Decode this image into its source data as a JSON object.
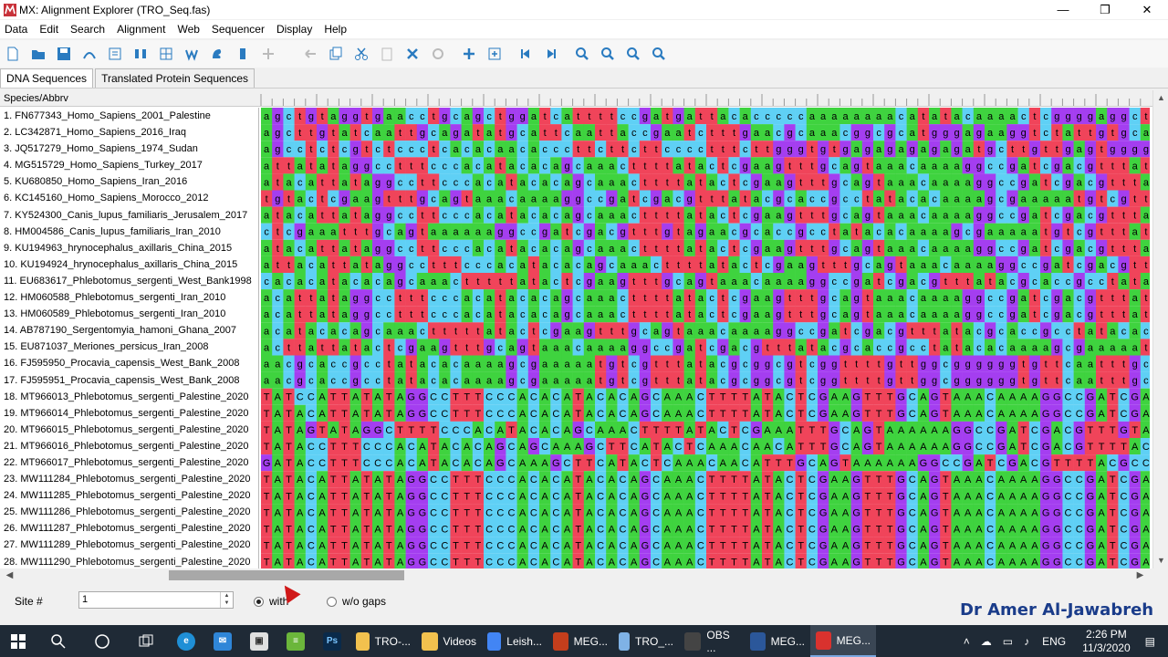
{
  "window": {
    "title": "MX: Alignment Explorer (TRO_Seq.fas)",
    "minimize": "—",
    "restore": "❐",
    "close": "✕"
  },
  "menu": [
    "Data",
    "Edit",
    "Search",
    "Alignment",
    "Web",
    "Sequencer",
    "Display",
    "Help"
  ],
  "tabs": [
    "DNA Sequences",
    "Translated Protein Sequences"
  ],
  "header": {
    "species_col": "Species/Abbrv"
  },
  "sequences": [
    {
      "name": "1. FN677343_Homo_Sapiens_2001_Palestine",
      "seq": "agctgtaggtgaacctgcagctggatcattttccgatgattacacccccaaaaaaaacatatacaaaactcggggaggct"
    },
    {
      "name": "2. LC342871_Homo_Sapiens_2016_Iraq",
      "seq": "agcttgtatcaattgcagatatgcattcaattaccgaatctttgaacgcaaacggcgcatgggagaaggtctattgtgcat"
    },
    {
      "name": "3. JQ517279_Homo_Sapiens_1974_Sudan",
      "seq": "agcctctcgtctccctcacacaacacccttcttcttcccctttcttgggtgtgagagagagagatgcttgttgagtgggg"
    },
    {
      "name": "4. MG515729_Homo_Sapiens_Turkey_2017",
      "seq": "attatataggcctttcccacatacacagcaaacttttatactcgaagtttgcagtaaacaaaaggccgatcgacgtttatc"
    },
    {
      "name": "5. KU680850_Homo_Sapiens_Iran_2016",
      "seq": "atacattataggccttcccacatacacagcaaacttttatactcgaagtttgcagtaaacaaaaggccgatcgacgtttat"
    },
    {
      "name": "6. KC145160_Homo_Sapiens_Morocco_2012",
      "seq": "tgtactcgaagtttgcagtaaacaaaaggccgatcgacgtttatacgcaccgcctatacacaaaagcgaaaaatgtcgtta"
    },
    {
      "name": "7. KY524300_Canis_lupus_familiaris_Jerusalem_2017",
      "seq": "atacattataggccttcccacatacacagcaaacttttatactcgaagtttgcagtaaacaaaaggccgatcgacgtttat"
    },
    {
      "name": "8. HM004586_Canis_lupus_familiaris_Iran_2010",
      "seq": "ctcgaaatttgcagtaaaaaaggccgatcgacgtttgtagaacgcaccgcctatacacaaaagcgaaaaatgtcgtttat"
    },
    {
      "name": "9. KU194963_hrynocephalus_axillaris_China_2015",
      "seq": "atacattataggccttcccacatacacagcaaacttttatactcgaagtttgcagtaaacaaaaggccgatcgacgtttat"
    },
    {
      "name": "10. KU194924_hrynocephalus_axillaris_China_2015",
      "seq": "attacattataggcctttcccacatacacagcaaacttttatactcgaagtttgcagtaaacaaaaggccgatcgacgttt"
    },
    {
      "name": "11. EU683617_Phlebotomus_sergenti_West_Bank1998",
      "seq": "cacacatacacagcaaactttttatactcgaagtttgcagtaaacaaaaggccgatcgacgtttatacgcaccgcctatac"
    },
    {
      "name": "12. HM060588_Phlebotomus_sergenti_Iran_2010",
      "seq": "acattataggcctttcccacatacacagcaaacttttatactcgaagtttgcagtaaacaaaaggccgatcgacgtttata"
    },
    {
      "name": "13. HM060589_Phlebotomus_sergenti_Iran_2010",
      "seq": "acattataggcctttcccacatacacagcaaacttttatactcgaagtttgcagtaaacaaaaggccgatcgacgtttata"
    },
    {
      "name": "14. AB787190_Sergentomyia_hamoni_Ghana_2007",
      "seq": "acatacacagcaaactttttatactcgaagtttgcagtaaacaaaaggccgatcgacgtttatacgcaccgcctatacaca"
    },
    {
      "name": "15. EU871037_Meriones_persicus_Iran_2008",
      "seq": "acttattatactcgaagtttgcagtaaacaaaaggccgatcgacgtttatacgcaccgcctatacacaaaagcgaaaaatg"
    },
    {
      "name": "16. FJ595950_Procavia_capensis_West_Bank_2008",
      "seq": "aacgcaccgcctatacacaaaagcgaaaaatgtcgtttatacgcggcgtcggttttgttggcggggggtgttcaatttgc"
    },
    {
      "name": "17. FJ595951_Procavia_capensis_West_Bank_2008",
      "seq": "aacgcaccgcctatacacaaaagcgaaaaatgtcgtttatacgcggcgtcggttttgttggcggggggtgttcaatttgc"
    },
    {
      "name": "18. MT966013_Phlebotomus_sergenti_Palestine_2020",
      "seq": "TATCCATTATATAGGCCTTTCCCACACATACACAGCAAACTTTTATACTCGAAGTTTGCAGTAAACAAAAGGCCGATCGA"
    },
    {
      "name": "19. MT966014_Phlebotomus_sergenti_Palestine_2020",
      "seq": "TATACATTATATAGGCCTTTCCCACACATACACAGCAAACTTTTATACTCGAAGTTTGCAGTAAACAAAAGGCCGATCGA"
    },
    {
      "name": "20. MT966015_Phlebotomus_sergenti_Palestine_2020",
      "seq": "TATAGTATAGGCTTTTCCCACATACACAGCAAACTTTTATACTCGAAATTTGCAGTAAAAAAGGCCGATCGACGTTTGTA"
    },
    {
      "name": "21. MT966016_Phlebotomus_sergenti_Palestine_2020",
      "seq": "TATACCTTTCCCACATACACAGCAGCAAAGCTTCATACTCAAACAACATTTGCAGTAAAAAAGGCCGATCGACGTTTTAC"
    },
    {
      "name": "22. MT966017_Phlebotomus_sergenti_Palestine_2020",
      "seq": "GATACCTTTCCCACATACACAGCAAAGCTTCATACTCAAACAACATTTGCAGTAAAAAAGGCCGATCGACGTTTTACGCC"
    },
    {
      "name": "23. MW111284_Phlebotomus_sergenti_Palestine_2020",
      "seq": "TATACATTATATAGGCCTTTCCCACACATACACAGCAAACTTTTATACTCGAAGTTTGCAGTAAACAAAAGGCCGATCGA"
    },
    {
      "name": "24. MW111285_Phlebotomus_sergenti_Palestine_2020",
      "seq": "TATACATTATATAGGCCTTTCCCACACATACACAGCAAACTTTTATACTCGAAGTTTGCAGTAAACAAAAGGCCGATCGA"
    },
    {
      "name": "25. MW111286_Phlebotomus_sergenti_Palestine_2020",
      "seq": "TATACATTATATAGGCCTTTCCCACACATACACAGCAAACTTTTATACTCGAAGTTTGCAGTAAACAAAAGGCCGATCGA"
    },
    {
      "name": "26. MW111287_Phlebotomus_sergenti_Palestine_2020",
      "seq": "TATACATTATATAGGCCTTTCCCACACATACACAGCAAACTTTTATACTCGAAGTTTGCAGTAAACAAAAGGCCGATCGA"
    },
    {
      "name": "27. MW111289_Phlebotomus_sergenti_Palestine_2020",
      "seq": "TATACATTATATAGGCCTTTCCCACACATACACAGCAAACTTTTATACTCGAAGTTTGCAGTAAACAAAAGGCCGATCGA"
    },
    {
      "name": "28. MW111290_Phlebotomus_sergenti_Palestine_2020",
      "seq": "TATACATTATATAGGCCTTTCCCACACATACACAGCAAACTTTTATACTCGAAGTTTGCAGTAAACAAAAGGCCGATCGA"
    }
  ],
  "nucleotide_colors": {
    "a": "#3fd33f",
    "t": "#f0445a",
    "c": "#5fd0f5",
    "g": "#a43ef0"
  },
  "status": {
    "site_label": "Site #",
    "site_value": "1",
    "with_label": "with",
    "without_label": "w/o gaps"
  },
  "watermark": "Dr Amer Al-Jawabreh",
  "taskbar": {
    "items": [
      {
        "label": "TRO-...",
        "icon": "folder-icon",
        "color": "#f2c14e"
      },
      {
        "label": "Videos",
        "icon": "folder-icon",
        "color": "#f2c14e"
      },
      {
        "label": "Leish...",
        "icon": "chrome-icon",
        "color": "#4285f4"
      },
      {
        "label": "MEG...",
        "icon": "powerpoint-icon",
        "color": "#c43e1c"
      },
      {
        "label": "TRO_...",
        "icon": "notepad-icon",
        "color": "#7fb2e6"
      },
      {
        "label": "OBS ...",
        "icon": "obs-icon",
        "color": "#444444"
      },
      {
        "label": "MEG...",
        "icon": "word-icon",
        "color": "#2b579a"
      },
      {
        "label": "MEG...",
        "icon": "mega-icon",
        "color": "#d9322e"
      }
    ],
    "lang": "ENG",
    "time": "2:26 PM",
    "date": "11/3/2020"
  }
}
